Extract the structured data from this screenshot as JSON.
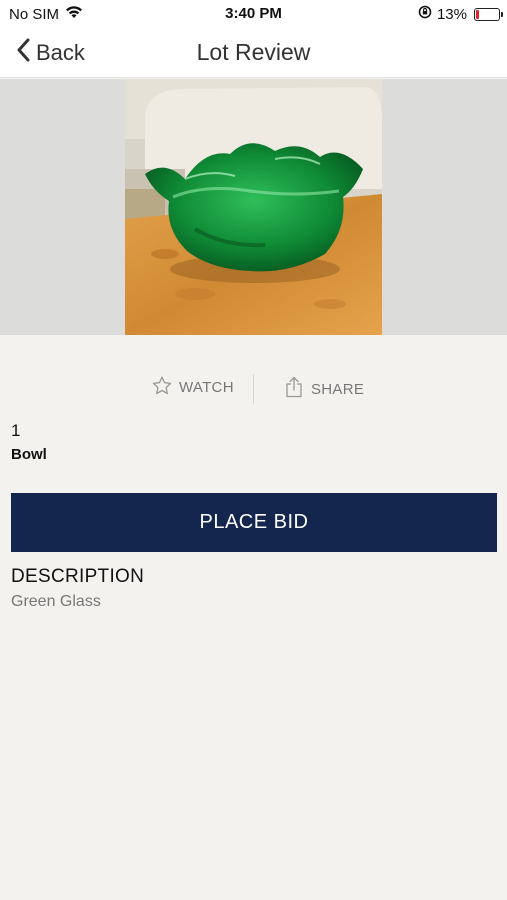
{
  "status_bar": {
    "carrier": "No SIM",
    "time": "3:40 PM",
    "battery_percent": "13%",
    "icons": [
      "wifi-icon",
      "orientation-lock-icon",
      "battery-icon"
    ],
    "battery_level": 0.13,
    "battery_color": "#e0242b"
  },
  "nav": {
    "back_label": "Back",
    "title": "Lot Review"
  },
  "lot": {
    "image_icon": "green-glass-bowl-photo",
    "number": "1",
    "name": "Bowl"
  },
  "actions": {
    "watch_label": "WATCH",
    "watch_icon": "star-outline-icon",
    "share_label": "SHARE",
    "share_icon": "share-icon"
  },
  "bid": {
    "button_label": "PLACE BID",
    "button_color": "#15264e"
  },
  "description": {
    "heading": "DESCRIPTION",
    "text": "Green Glass"
  }
}
